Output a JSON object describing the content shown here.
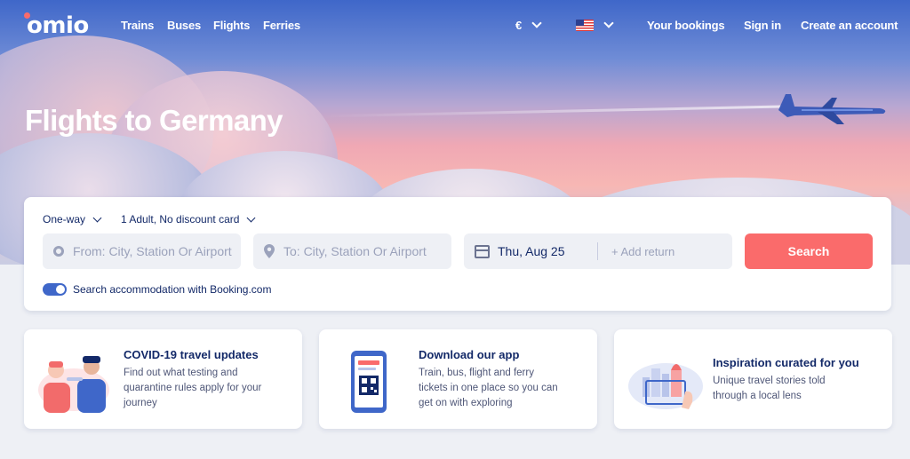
{
  "nav": {
    "logo": "omio",
    "links": [
      "Trains",
      "Buses",
      "Flights",
      "Ferries"
    ],
    "currency": "€",
    "your_bookings": "Your bookings",
    "sign_in": "Sign in",
    "create_account": "Create an account"
  },
  "hero": {
    "title": "Flights to Germany"
  },
  "search": {
    "trip_type": "One-way",
    "passengers": "1 Adult, No discount card",
    "from_placeholder": "From: City, Station Or Airport",
    "to_placeholder": "To: City, Station Or Airport",
    "date": "Thu, Aug 25",
    "add_return": "+ Add return",
    "button": "Search",
    "accommodation_label": "Search accommodation with Booking.com"
  },
  "promos": [
    {
      "title": "COVID-19 travel updates",
      "desc_lines": [
        "Find out what testing and",
        "quarantine rules apply for your",
        "journey"
      ]
    },
    {
      "title": "Download our app",
      "desc_lines": [
        "Train, bus, flight and ferry",
        "tickets in one place so you can",
        "get on with exploring"
      ]
    },
    {
      "title": "Inspiration curated for you",
      "desc_lines": [
        "Unique travel stories told",
        "through a local lens"
      ]
    }
  ],
  "colors": {
    "accent": "#fa6b6b",
    "brand_blue": "#132968",
    "toggle": "#3f67c9"
  },
  "icons": {
    "from": "location-circle-icon",
    "to": "map-pin-icon",
    "date": "calendar-icon",
    "language": "us-flag-icon"
  }
}
